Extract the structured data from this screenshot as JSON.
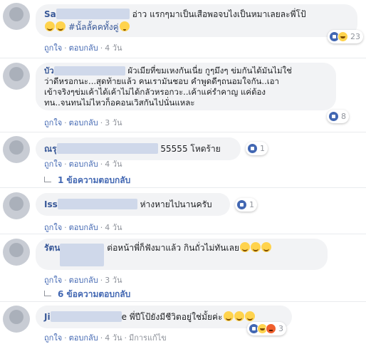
{
  "actions": {
    "like": "ถูกใจ",
    "reply": "ตอบกลับ",
    "dot": "·",
    "edited": "มีการแก้ไข"
  },
  "comments": [
    {
      "name_visible": "Sa",
      "text": "อ่าว แรกๆมาเป็นเสือพอจบไงเป็นหมาเลยละพี่โป้",
      "text2": "#นั้ลลั้คคทั้งคู่",
      "reactions": [
        "like-icon",
        "haha-icon"
      ],
      "reaction_count": "23",
      "time": "4 วัน"
    },
    {
      "name_visible": "บัว",
      "lines": [
        "ผัวเมียที่ขมเหงกันเนี่ย กูๆมึงๆ ข่มกันได้มันไม่ใช่",
        "ว่าดีหรอกนะ...สุดท้ายแล้ว คนเรามันชอบ คำพูดดีๆถนอมใจกัน..เอา",
        "เข้าจริงๆข่มเค้าได้เค้าไม่ได้กลัวหรอกวะ..เค้าแค่รำคาญ แค่ต้อง",
        "ทน..จนทนไม่ไหวก็อคอนเวิสกันไปนั่นแหละ"
      ],
      "reactions": [
        "like-icon"
      ],
      "reaction_count": "8",
      "time": "3 วัน"
    },
    {
      "name_visible": "ณรุ",
      "text": "55555 โหดร้าย",
      "reactions": [
        "like-icon"
      ],
      "reaction_count": "1",
      "time": "4 วัน",
      "replies_label": "1 ข้อความตอบกลับ"
    },
    {
      "name_visible": "Iss",
      "text": "ห่างหายไปนานครับ",
      "reactions": [
        "like-icon"
      ],
      "reaction_count": "1",
      "time": "4 วัน"
    },
    {
      "name_visible": "รัตน",
      "text": "ต่อหน้าพี่ก็ฟังมาแล้ว กินถั่วไม่ทันเลย",
      "time": "3 วัน",
      "replies_label": "6 ข้อความตอบกลับ"
    },
    {
      "name_visible": "Ji",
      "text": "e พี่ปีโป้ยังมีชีวิตอยู่ใช่มั้ยค่ะ",
      "reactions": [
        "like-icon",
        "haha-icon",
        "angry-icon"
      ],
      "reaction_count": "3",
      "time": "4 วัน"
    }
  ]
}
